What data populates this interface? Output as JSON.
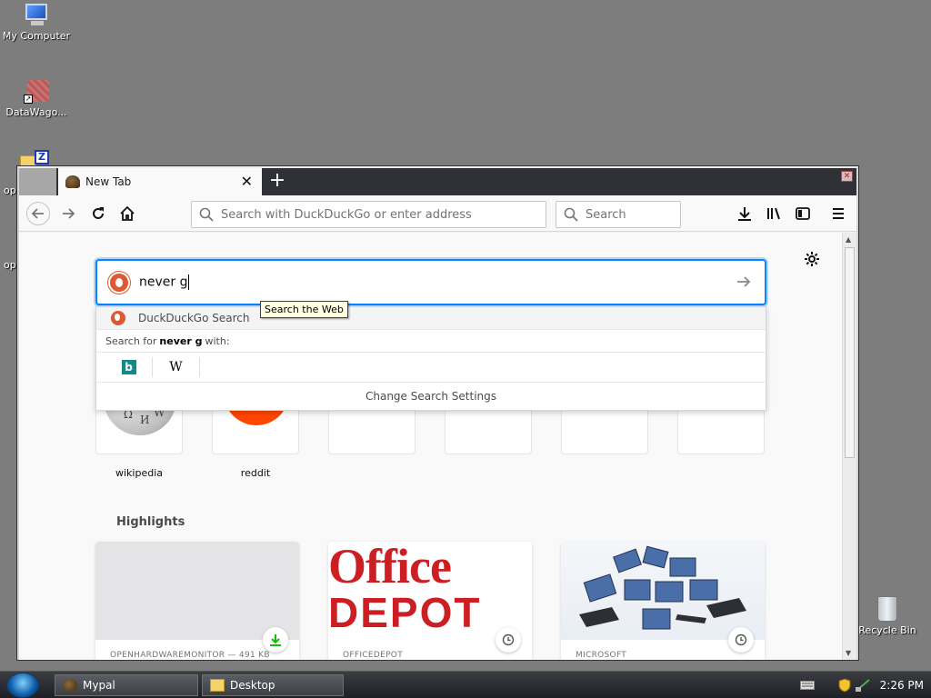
{
  "desktop": {
    "icons": [
      {
        "label": "My Computer"
      },
      {
        "label": "DataWago..."
      },
      {
        "label": "op"
      },
      {
        "label": "op"
      }
    ],
    "recycle_bin": "Recycle Bin"
  },
  "browser": {
    "tab_title": "New Tab",
    "url_placeholder": "Search with DuckDuckGo or enter address",
    "search_placeholder": "Search",
    "search_box": {
      "typed": "never g",
      "tooltip": "Search the Web"
    },
    "dropdown": {
      "engine_row": "DuckDuckGo Search",
      "search_for_prefix": "Search for",
      "search_for_term": "never g",
      "search_for_suffix": "with:",
      "change_settings": "Change Search Settings"
    },
    "top_sites": [
      {
        "label": "wikipedia"
      },
      {
        "label": "reddit"
      },
      {
        "label": ""
      },
      {
        "label": ""
      },
      {
        "label": ""
      },
      {
        "label": ""
      }
    ],
    "highlights_title": "Highlights",
    "highlights": [
      {
        "source": "OPENHARDWAREMONITOR — 491 KB",
        "badge": "download-icon"
      },
      {
        "source": "OFFICEDEPOT",
        "badge": "clock-icon",
        "logo_line1": "Office",
        "logo_line2": "DEPOT"
      },
      {
        "source": "MICROSOFT",
        "badge": "clock-icon"
      }
    ]
  },
  "taskbar": {
    "items": [
      {
        "label": "Mypal"
      },
      {
        "label": "Desktop"
      }
    ],
    "clock": "2:26 PM"
  },
  "colors": {
    "accent": "#0a84ff",
    "ddg": "#de5833",
    "reddit": "#ff4500",
    "officedepot": "#cc1f24"
  }
}
